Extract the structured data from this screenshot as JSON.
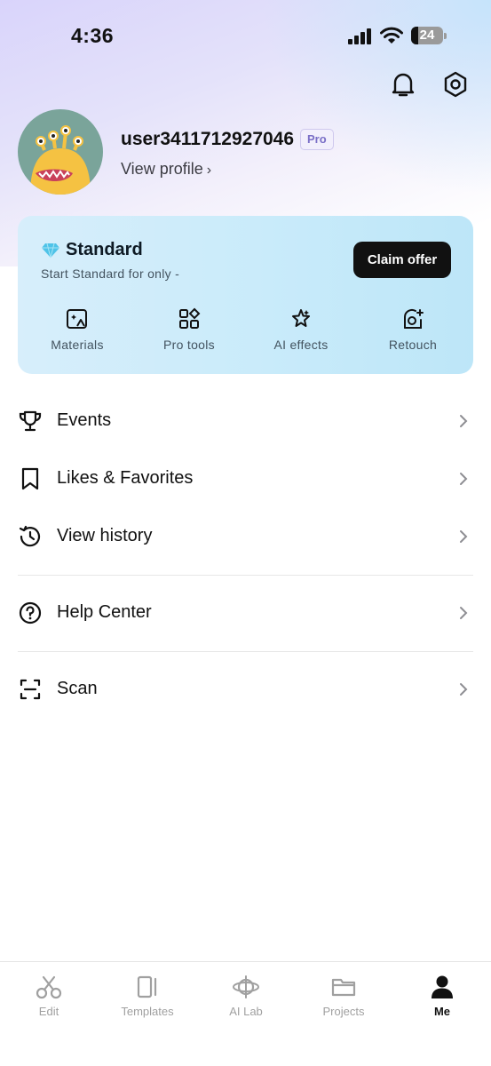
{
  "status_bar": {
    "time": "4:36",
    "battery": "24"
  },
  "profile": {
    "username": "user3411712927046",
    "badge": "Pro",
    "view_profile_label": "View profile",
    "view_profile_chevron": "›"
  },
  "plan_card": {
    "title": "Standard",
    "subtitle": "Start Standard for only -",
    "cta_label": "Claim offer",
    "features": [
      {
        "label": "Materials",
        "icon": "materials-icon"
      },
      {
        "label": "Pro tools",
        "icon": "pro-tools-icon"
      },
      {
        "label": "AI effects",
        "icon": "ai-effects-icon"
      },
      {
        "label": "Retouch",
        "icon": "retouch-icon"
      }
    ]
  },
  "menu": {
    "items": [
      {
        "label": "Events",
        "icon": "trophy-icon"
      },
      {
        "label": "Likes & Favorites",
        "icon": "bookmark-icon"
      },
      {
        "label": "View history",
        "icon": "history-icon"
      },
      {
        "label": "Help Center",
        "icon": "help-icon"
      },
      {
        "label": "Scan",
        "icon": "scan-icon"
      }
    ]
  },
  "tab_bar": {
    "tabs": [
      {
        "label": "Edit",
        "icon": "scissors-icon",
        "active": false
      },
      {
        "label": "Templates",
        "icon": "templates-icon",
        "active": false
      },
      {
        "label": "AI Lab",
        "icon": "ai-lab-icon",
        "active": false
      },
      {
        "label": "Projects",
        "icon": "folder-icon",
        "active": false
      },
      {
        "label": "Me",
        "icon": "person-icon",
        "active": true
      }
    ]
  },
  "colors": {
    "accent_dark": "#111111",
    "card_bg": "#c9ebfa",
    "diamond": "#4fc3e8",
    "pro_badge": "#7a6fc7"
  }
}
